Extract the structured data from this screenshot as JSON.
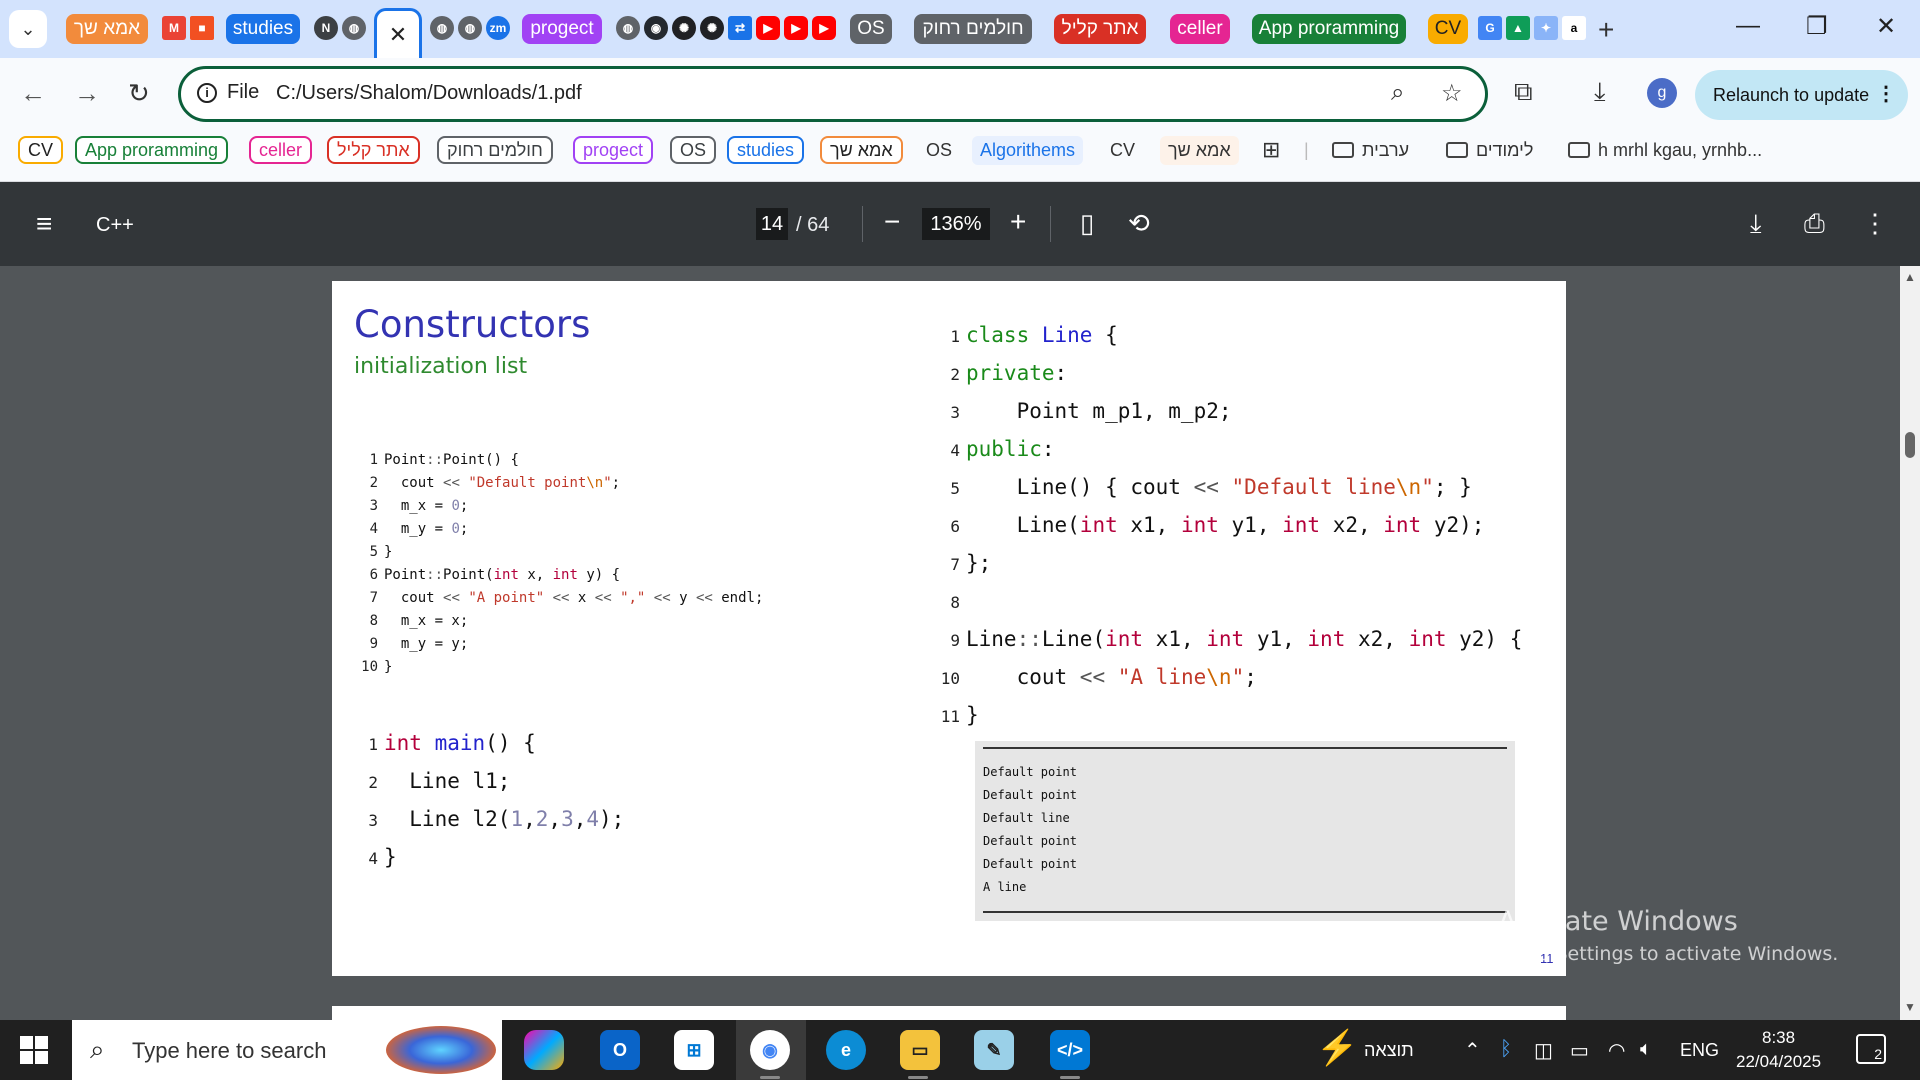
{
  "tabstrip": {
    "groups": [
      {
        "label": "אמא שך",
        "color": "#f28b3c"
      },
      {
        "label": "studies",
        "color": "#1a73e8"
      },
      {
        "label": "progect",
        "color": "#a142f4"
      },
      {
        "label": "OS",
        "color": "#5f6368"
      },
      {
        "label": "חולמים רחוק",
        "color": "#5f6368"
      },
      {
        "label": "אתר קליל",
        "color": "#d93025"
      },
      {
        "label": "celler",
        "color": "#e52592"
      },
      {
        "label": "App proramming",
        "color": "#188038"
      },
      {
        "label": "CV",
        "color": "#f9ab00"
      }
    ],
    "active_tab_icon": "close-icon",
    "new_tab": "+",
    "window_controls": {
      "minimize": "—",
      "restore": "❐",
      "close": "✕"
    }
  },
  "toolbar": {
    "back": "←",
    "forward": "→",
    "reload": "↻",
    "url_scheme_label": "File",
    "url": "C:/Users/Shalom/Downloads/1.pdf",
    "profile_initial": "g",
    "relaunch_label": "Relaunch to update"
  },
  "bookmarks": {
    "chips": [
      {
        "label": "CV",
        "color": "#f9ab00"
      },
      {
        "label": "App proramming",
        "color": "#188038"
      },
      {
        "label": "celler",
        "color": "#e52592"
      },
      {
        "label": "אתר קליל",
        "color": "#d93025"
      },
      {
        "label": "חולמים רחוק",
        "color": "#5f6368"
      },
      {
        "label": "progect",
        "color": "#a142f4"
      },
      {
        "label": "OS",
        "color": "#5f6368"
      },
      {
        "label": "studies",
        "color": "#1a73e8"
      },
      {
        "label": "אמא שך",
        "color": "#f28b3c"
      }
    ],
    "plain": {
      "os": "OS",
      "algorithems": "Algorithems",
      "cv": "CV",
      "ima": "אמא שך"
    },
    "folders": {
      "f1": "ערבית",
      "f2": "לימודים",
      "f3": "h mrhl kgau, yrnhb..."
    }
  },
  "pdf_viewer": {
    "title": "C++",
    "current_page": "14",
    "page_total": "/ 64",
    "zoom": "136%"
  },
  "slide": {
    "title": "Constructors",
    "subtitle": "initialization list",
    "page_number": "11",
    "code_point": [
      "Point::Point() {",
      "  cout << \"Default point\\n\";",
      "  m_x = 0;",
      "  m_y = 0;",
      "}",
      "Point::Point(int x, int y) {",
      "  cout << \"A point\" << x << \",\" << y << endl;",
      "  m_x = x;",
      "  m_y = y;",
      "}"
    ],
    "code_main": [
      "int main() {",
      "  Line l1;",
      "  Line l2(1,2,3,4);",
      "}"
    ],
    "code_line": [
      "class Line {",
      "private:",
      "    Point m_p1, m_p2;",
      "public:",
      "    Line() { cout << \"Default line\\n\"; }",
      "    Line(int x1, int y1, int x2, int y2);",
      "};",
      "",
      "Line::Line(int x1, int y1, int x2, int y2) {",
      "    cout << \"A line\\n\";",
      "}"
    ],
    "output": [
      "Default point",
      "Default point",
      "Default line",
      "Default point",
      "Default point",
      "A line"
    ]
  },
  "watermark": {
    "title": "Activate Windows",
    "subtitle": "Go to Settings to activate Windows."
  },
  "taskbar": {
    "search_placeholder": "Type here to search",
    "tray_label": "תוצאה",
    "language": "ENG",
    "time": "8:38",
    "date": "22/04/2025",
    "notifications": "2"
  }
}
